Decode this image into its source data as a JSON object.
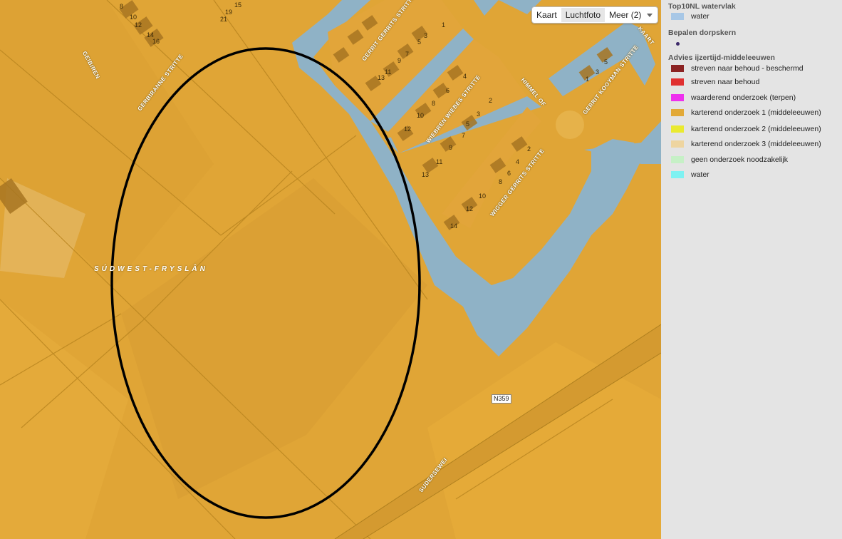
{
  "map": {
    "colors": {
      "land": "#e0a536",
      "water": "#8fb2c6",
      "roads": "#c98f24",
      "building": "#a77522",
      "ellipse": "#000000"
    },
    "street_labels": [
      "GEIBIREN",
      "GERBIRANNE STRITTE",
      "GERRIT GERRITS STRITTE",
      "WIEBREN WIEBES STRITTE",
      "GERRIT KOOYMAN STRITTE",
      "HIMMEL OF",
      "WIGGER GERRITS STRITTE",
      "SUDERSEWEI",
      "KAART"
    ],
    "house_numbers": [
      "8",
      "15",
      "19",
      "21",
      "10",
      "12",
      "14",
      "16",
      "5",
      "1",
      "3",
      "7",
      "9",
      "11",
      "13",
      "4",
      "6",
      "8",
      "10",
      "12",
      "2",
      "3",
      "5",
      "7",
      "9",
      "11",
      "13",
      "2",
      "4",
      "6",
      "8",
      "10",
      "12",
      "14",
      "1",
      "3",
      "5"
    ],
    "region_label": "SÚDWEST-FRYSLÂN",
    "road_shield": "N359",
    "map_type": {
      "kaart": "Kaart",
      "luchtfoto": "Luchtfoto",
      "meer": "Meer (2)",
      "selected": "Luchtfoto"
    }
  },
  "legend": {
    "sections": [
      {
        "title": "Top10NL watervlak",
        "items": [
          {
            "label": "water",
            "color": "#a7c7e6"
          }
        ]
      },
      {
        "title": "Bepalen dorpskern",
        "items": [
          {
            "label": "",
            "color": "#3d2a6a",
            "icon": "point-icon"
          }
        ]
      },
      {
        "title": "Advies ijzertijd-middeleeuwen",
        "items": [
          {
            "label": "streven naar behoud - beschermd",
            "color": "#8b2323"
          },
          {
            "label": "streven naar behoud",
            "color": "#e03030"
          },
          {
            "label": "waarderend onderzoek (terpen)",
            "color": "#ee30ee"
          },
          {
            "label": "karterend onderzoek 1 (middeleeuwen)",
            "color": "#e2a937"
          },
          {
            "label": "karterend onderzoek 2 (middeleeuwen)",
            "color": "#eaea30"
          },
          {
            "label": "karterend onderzoek 3 (middeleeuwen)",
            "color": "#eed5a0"
          },
          {
            "label": "geen onderzoek noodzakelijk",
            "color": "#c6f0c6"
          },
          {
            "label": "water",
            "color": "#7ff2f2"
          }
        ]
      }
    ]
  }
}
